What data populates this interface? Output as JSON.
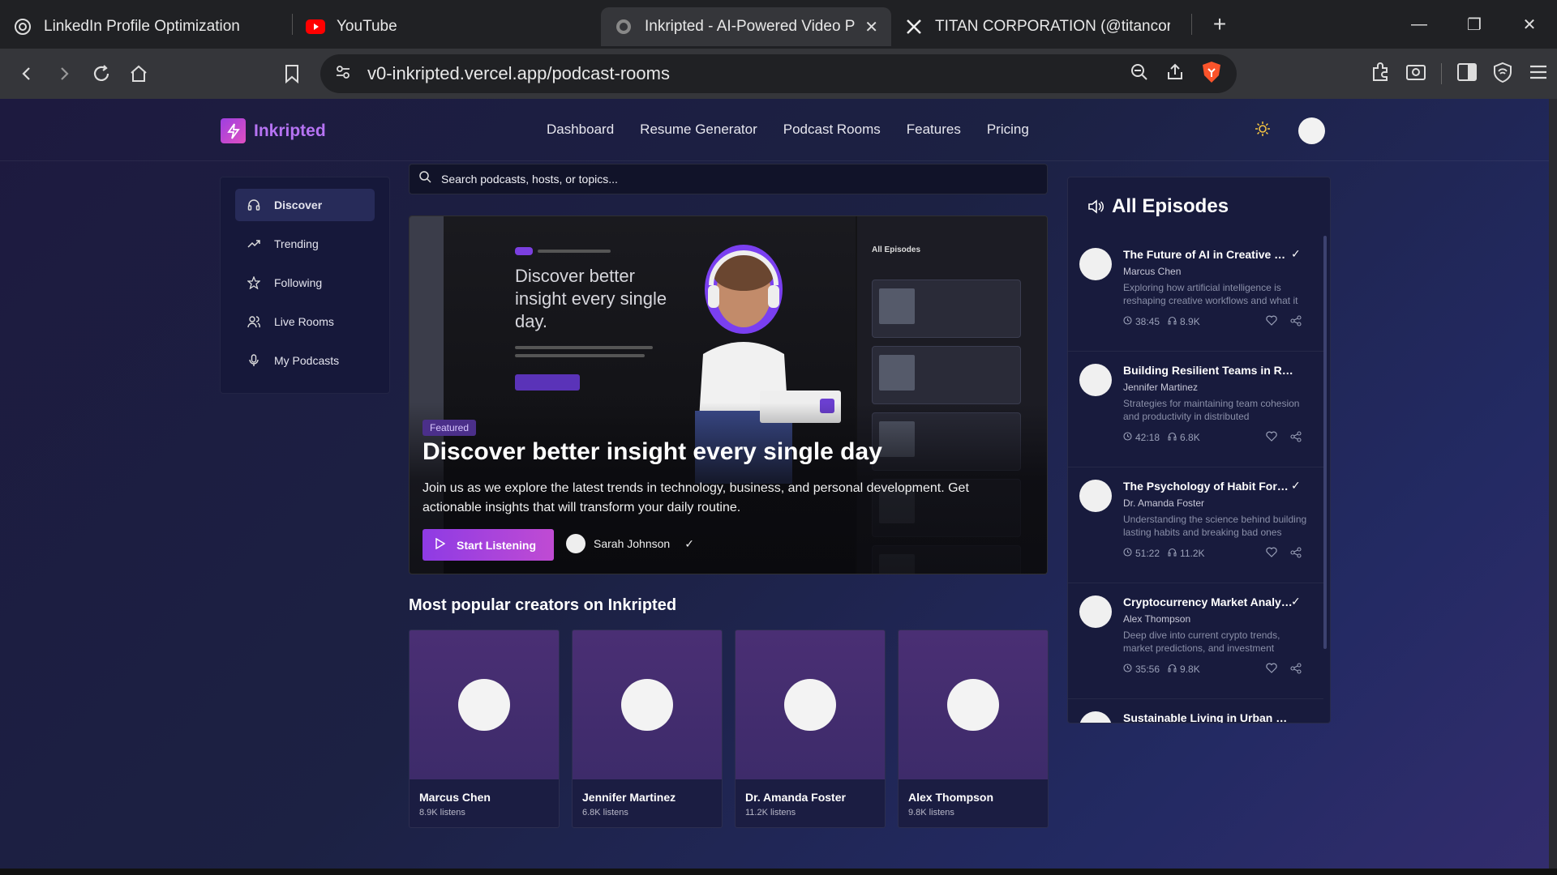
{
  "browser": {
    "tabs": [
      {
        "title": "LinkedIn Profile Optimization",
        "icon": "chatgpt-icon"
      },
      {
        "title": "YouTube",
        "icon": "youtube-icon"
      },
      {
        "title": "Inkripted - AI-Powered Video Pro",
        "icon": "globe-icon",
        "active": true
      },
      {
        "title": "TITAN CORPORATION (@titancorpng",
        "icon": "x-icon"
      }
    ],
    "url": "v0-inkripted.vercel.app/podcast-rooms"
  },
  "site": {
    "brand": "Inkripted",
    "nav": [
      "Dashboard",
      "Resume Generator",
      "Podcast Rooms",
      "Features",
      "Pricing"
    ],
    "accent": "#9b4ee6"
  },
  "sidebar": {
    "items": [
      {
        "label": "Discover",
        "icon": "headphones-icon",
        "active": true
      },
      {
        "label": "Trending",
        "icon": "trending-icon"
      },
      {
        "label": "Following",
        "icon": "star-icon"
      },
      {
        "label": "Live Rooms",
        "icon": "users-icon"
      },
      {
        "label": "My Podcasts",
        "icon": "microphone-icon"
      }
    ]
  },
  "search": {
    "placeholder": "Search podcasts, hosts, or topics..."
  },
  "hero": {
    "badge": "Featured",
    "title": "Discover better insight every single day",
    "description": "Join us as we explore the latest trends in technology, business, and personal development. Get actionable insights that will transform your daily routine.",
    "cta": "Start Listening",
    "host": "Sarah Johnson",
    "image_heading": "Discover better insight every single day.",
    "image_panel_title": "All Episodes"
  },
  "creators": {
    "title": "Most popular creators on Inkripted",
    "items": [
      {
        "name": "Marcus Chen",
        "listens": "8.9K listens"
      },
      {
        "name": "Jennifer Martinez",
        "listens": "6.8K listens"
      },
      {
        "name": "Dr. Amanda Foster",
        "listens": "11.2K listens"
      },
      {
        "name": "Alex Thompson",
        "listens": "9.8K listens"
      }
    ]
  },
  "episodes": {
    "title": "All Episodes",
    "items": [
      {
        "title": "The Future of AI in Creative Workflows",
        "host": "Marcus Chen",
        "desc": "Exploring how artificial intelligence is reshaping creative workflows and what it means",
        "duration": "38:45",
        "listens": "8.9K",
        "verified": "✓"
      },
      {
        "title": "Building Resilient Teams in Remote Work",
        "host": "Jennifer Martinez",
        "desc": "Strategies for maintaining team cohesion and productivity in distributed environments",
        "duration": "42:18",
        "listens": "6.8K",
        "verified": ""
      },
      {
        "title": "The Psychology of Habit Formation",
        "host": "Dr. Amanda Foster",
        "desc": "Understanding the science behind building lasting habits and breaking bad ones",
        "duration": "51:22",
        "listens": "11.2K",
        "verified": "✓"
      },
      {
        "title": "Cryptocurrency Market Analysis",
        "host": "Alex Thompson",
        "desc": "Deep dive into current crypto trends, market predictions, and investment strategies",
        "duration": "35:56",
        "listens": "9.8K",
        "verified": "✓"
      },
      {
        "title": "Sustainable Living in Urban Environments",
        "host": "",
        "desc": "",
        "duration": "",
        "listens": "",
        "verified": ""
      }
    ]
  }
}
